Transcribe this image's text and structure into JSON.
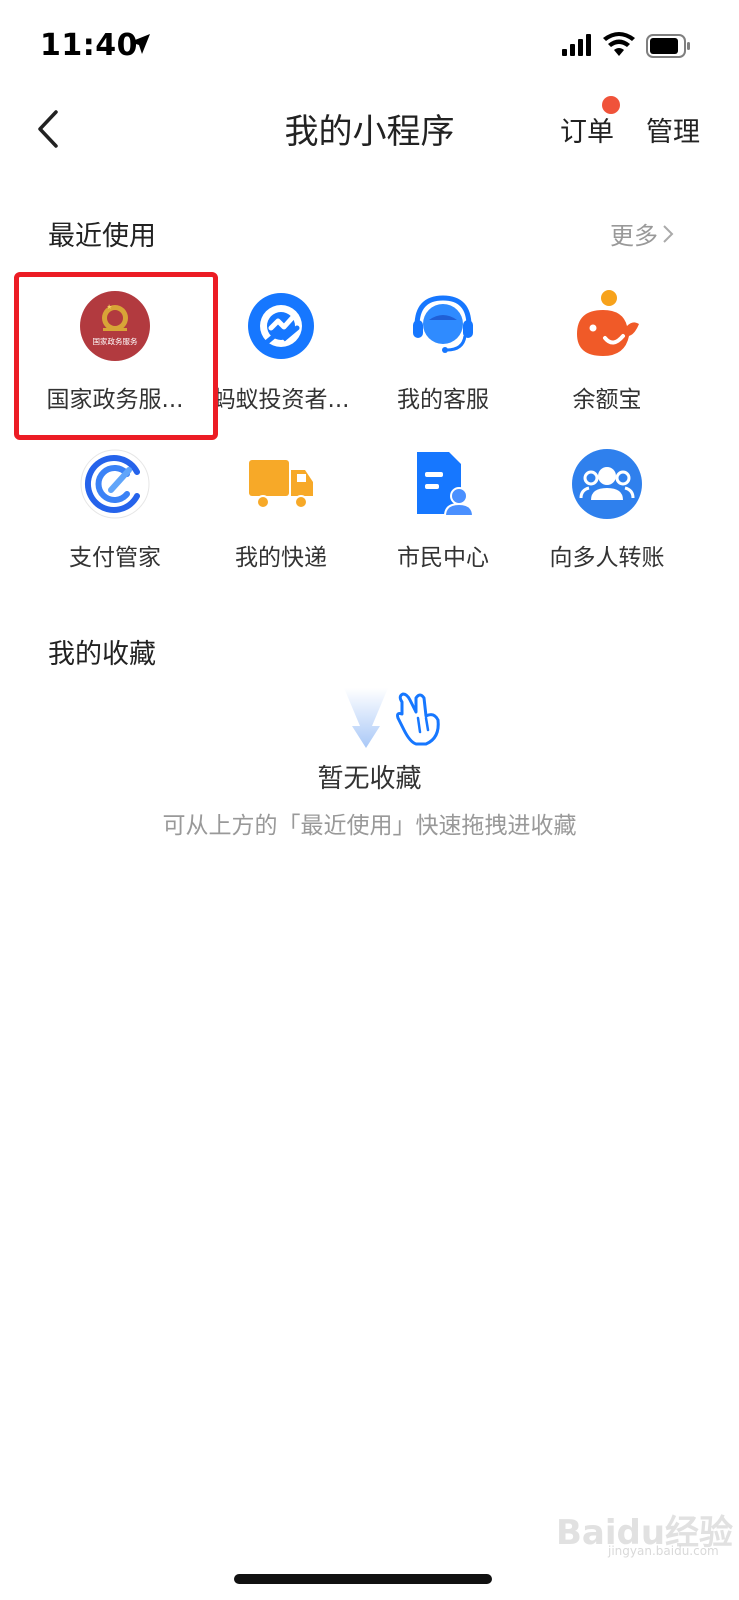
{
  "status_bar": {
    "time": "11:40"
  },
  "nav": {
    "title": "我的小程序",
    "orders_label": "订单",
    "manage_label": "管理"
  },
  "recent": {
    "title": "最近使用",
    "more_label": "更多",
    "items": [
      {
        "label": "国家政务服...",
        "icon": "national-gov-service-icon"
      },
      {
        "label": "蚂蚁投资者...",
        "icon": "ant-investor-icon"
      },
      {
        "label": "我的客服",
        "icon": "customer-service-icon"
      },
      {
        "label": "余额宝",
        "icon": "yuebao-icon"
      },
      {
        "label": "支付管家",
        "icon": "payment-manager-icon"
      },
      {
        "label": "我的快递",
        "icon": "delivery-truck-icon"
      },
      {
        "label": "市民中心",
        "icon": "citizen-center-icon"
      },
      {
        "label": "向多人转账",
        "icon": "multi-transfer-icon"
      }
    ],
    "gov_badge_text": "国家政务服务"
  },
  "favorites": {
    "title": "我的收藏",
    "empty_title": "暂无收藏",
    "empty_hint": "可从上方的「最近使用」快速拖拽进收藏"
  },
  "watermark": {
    "text": "Baidu经验",
    "sub": "jingyan.baidu.com"
  },
  "colors": {
    "highlight": "#ec1c24",
    "badge_dot": "#f0533a",
    "blue": "#1677ff"
  }
}
